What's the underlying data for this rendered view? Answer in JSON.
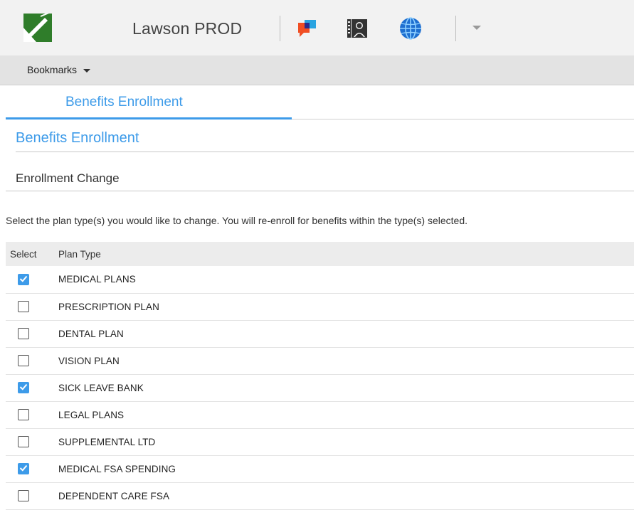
{
  "header": {
    "app_title": "Lawson PROD",
    "icons": [
      "lawson-logo-icon",
      "chat-bubbles-icon",
      "person-document-icon",
      "globe-icon",
      "chevron-down-icon"
    ]
  },
  "bookmarks": {
    "label": "Bookmarks"
  },
  "tabs": [
    {
      "label": "Benefits Enrollment",
      "active": true
    }
  ],
  "page": {
    "title": "Benefits Enrollment",
    "section": "Enrollment Change",
    "instructions": "Select the plan type(s) you would like to change. You will re-enroll for benefits within the type(s) selected."
  },
  "table": {
    "columns": [
      "Select",
      "Plan Type"
    ],
    "rows": [
      {
        "plan_type": "MEDICAL PLANS",
        "selected": true
      },
      {
        "plan_type": "PRESCRIPTION PLAN",
        "selected": false
      },
      {
        "plan_type": "DENTAL PLAN",
        "selected": false
      },
      {
        "plan_type": "VISION PLAN",
        "selected": false
      },
      {
        "plan_type": "SICK LEAVE BANK",
        "selected": true
      },
      {
        "plan_type": "LEGAL PLANS",
        "selected": false
      },
      {
        "plan_type": "SUPPLEMENTAL LTD",
        "selected": false
      },
      {
        "plan_type": "MEDICAL FSA SPENDING",
        "selected": true
      },
      {
        "plan_type": "DEPENDENT CARE FSA",
        "selected": false
      }
    ]
  },
  "colors": {
    "accent": "#3d9be9",
    "logo_green": "#2f7d2a",
    "header_bg": "#f2f2f2",
    "bookmarks_bg": "#e3e3e3"
  }
}
